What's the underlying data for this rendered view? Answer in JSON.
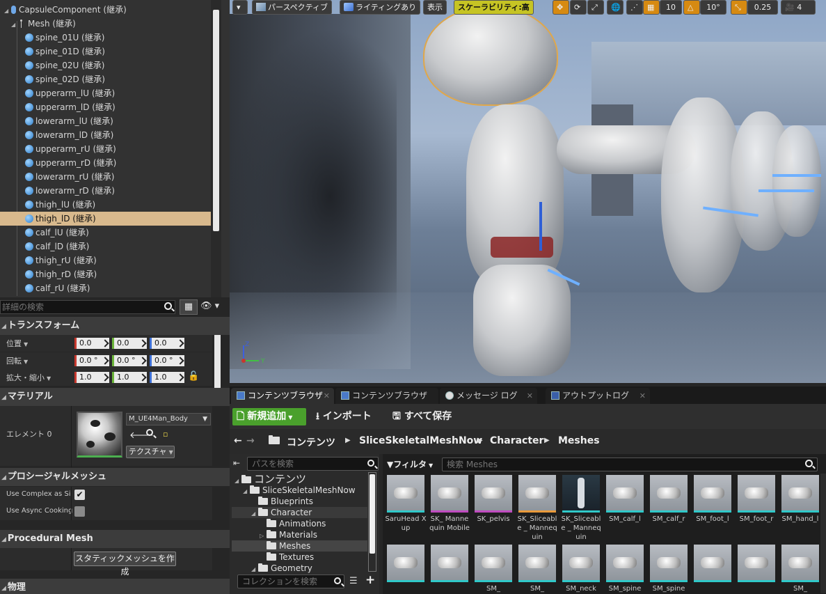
{
  "tree": {
    "items": [
      {
        "label": "CapsuleComponent (継承)",
        "kind": "capsule",
        "indent": 0,
        "expanded": true
      },
      {
        "label": "Mesh (継承)",
        "kind": "mesh",
        "indent": 1,
        "expanded": true
      },
      {
        "label": "spine_01U (継承)",
        "kind": "bone",
        "indent": 2
      },
      {
        "label": "spine_01D (継承)",
        "kind": "bone",
        "indent": 2
      },
      {
        "label": "spine_02U (継承)",
        "kind": "bone",
        "indent": 2
      },
      {
        "label": "spine_02D (継承)",
        "kind": "bone",
        "indent": 2
      },
      {
        "label": "upperarm_lU (継承)",
        "kind": "bone",
        "indent": 2
      },
      {
        "label": "upperarm_lD (継承)",
        "kind": "bone",
        "indent": 2
      },
      {
        "label": "lowerarm_lU (継承)",
        "kind": "bone",
        "indent": 2
      },
      {
        "label": "lowerarm_lD (継承)",
        "kind": "bone",
        "indent": 2
      },
      {
        "label": "upperarm_rU (継承)",
        "kind": "bone",
        "indent": 2
      },
      {
        "label": "upperarm_rD (継承)",
        "kind": "bone",
        "indent": 2
      },
      {
        "label": "lowerarm_rU (継承)",
        "kind": "bone",
        "indent": 2
      },
      {
        "label": "lowerarm_rD (継承)",
        "kind": "bone",
        "indent": 2
      },
      {
        "label": "thigh_lU (継承)",
        "kind": "bone",
        "indent": 2
      },
      {
        "label": "thigh_lD (継承)",
        "kind": "bone",
        "indent": 2,
        "selected": true
      },
      {
        "label": "calf_lU (継承)",
        "kind": "bone",
        "indent": 2
      },
      {
        "label": "calf_lD (継承)",
        "kind": "bone",
        "indent": 2
      },
      {
        "label": "thigh_rU (継承)",
        "kind": "bone",
        "indent": 2
      },
      {
        "label": "thigh_rD (継承)",
        "kind": "bone",
        "indent": 2
      },
      {
        "label": "calf_rU (継承)",
        "kind": "bone",
        "indent": 2
      }
    ]
  },
  "details": {
    "search_placeholder": "詳細の検索",
    "transform": {
      "header": "トランスフォーム",
      "location_label": "位置",
      "location": [
        "0.0",
        "0.0",
        "0.0"
      ],
      "rotation_label": "回転",
      "rotation": [
        "0.0 °",
        "0.0 °",
        "0.0 °"
      ],
      "scale_label": "拡大・縮小",
      "scale": [
        "1.0",
        "1.0",
        "1.0"
      ]
    },
    "materials": {
      "header": "マテリアル",
      "element_label": "エレメント 0",
      "material_name": "M_UE4Man_Body",
      "textures_button": "テクスチャ"
    },
    "procedural": {
      "header": "プロシージャルメッシュ",
      "use_complex_label": "Use Complex as Si",
      "use_complex_checked": true,
      "use_async_label": "Use Async Cooking",
      "use_async_checked": false
    },
    "procedural_en": {
      "header": "Procedural Mesh",
      "create_static_button": "スタティックメッシュを作成"
    },
    "physics": {
      "header": "物理"
    }
  },
  "viewport": {
    "toolbar": {
      "perspective": "パースペクティブ",
      "lighting": "ライティングあり",
      "show": "表示",
      "scalability": "スケーラビリティ:高",
      "grid_snap": "10",
      "rot_snap": "10°",
      "scale_snap": "0.25",
      "camera_speed": "4"
    },
    "axis": {
      "z": "Z",
      "y": "Y"
    }
  },
  "content_browser": {
    "tabs": [
      {
        "label": "コンテンツブラウザ",
        "active": true
      },
      {
        "label": "コンテンツブラウザ",
        "active": false
      },
      {
        "label": "メッセージ ログ",
        "active": false
      },
      {
        "label": "アウトプットログ",
        "active": false
      }
    ],
    "new_button": "新規追加",
    "import_button": "インポート",
    "save_all_button": "すべて保存",
    "breadcrumbs": [
      "コンテンツ",
      "SliceSkeletalMeshNow",
      "Character",
      "Meshes"
    ],
    "path_search_placeholder": "パスを検索",
    "folders": [
      {
        "label": "コンテンツ",
        "level": 0
      },
      {
        "label": "SliceSkeletalMeshNow",
        "level": 1
      },
      {
        "label": "Blueprints",
        "level": 2
      },
      {
        "label": "Character",
        "level": 2,
        "hover": true
      },
      {
        "label": "Animations",
        "level": 3
      },
      {
        "label": "Materials",
        "level": 3
      },
      {
        "label": "Meshes",
        "level": 3,
        "selected": true
      },
      {
        "label": "Textures",
        "level": 3
      },
      {
        "label": "Geometry",
        "level": 2
      }
    ],
    "collection_search_placeholder": "コレクションを検索",
    "filter_label": "フィルタ",
    "asset_search_placeholder": "検索 Meshes",
    "assets_row1": [
      {
        "label": "SaruHead Xup",
        "color": "cyan"
      },
      {
        "label": "SK_ Mannequin Mobile",
        "color": "magenta"
      },
      {
        "label": "SK_pelvis",
        "color": "magenta"
      },
      {
        "label": "SK_Sliceable _ Mannequin",
        "color": "orange"
      },
      {
        "label": "SK_Sliceable _ Mannequin",
        "color": "dark"
      },
      {
        "label": "SM_calf_l",
        "color": "cyan"
      },
      {
        "label": "SM_calf_r",
        "color": "cyan"
      },
      {
        "label": "SM_foot_l",
        "color": "cyan"
      },
      {
        "label": "SM_foot_r",
        "color": "cyan"
      },
      {
        "label": "SM_hand_l",
        "color": "cyan"
      }
    ],
    "assets_row2": [
      {
        "label": "",
        "color": "cyan"
      },
      {
        "label": "",
        "color": "cyan"
      },
      {
        "label": "SM_",
        "color": "cyan"
      },
      {
        "label": "SM_",
        "color": "cyan"
      },
      {
        "label": "SM_neck",
        "color": "cyan"
      },
      {
        "label": "SM_spine",
        "color": "cyan"
      },
      {
        "label": "SM_spine",
        "color": "cyan"
      },
      {
        "label": "",
        "color": "cyan"
      },
      {
        "label": "",
        "color": "cyan"
      },
      {
        "label": "SM_",
        "color": "cyan"
      }
    ]
  }
}
